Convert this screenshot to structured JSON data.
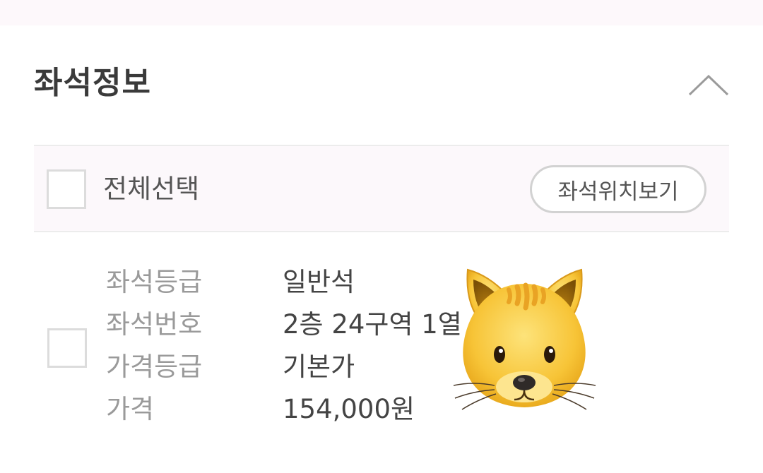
{
  "section": {
    "title": "좌석정보",
    "collapse_icon": "chevron-up-icon"
  },
  "select_bar": {
    "select_all_label": "전체선택",
    "seat_location_button": "좌석위치보기"
  },
  "seat_item": {
    "rows": [
      {
        "label": "좌석등급",
        "value": "일반석"
      },
      {
        "label": "좌석번호",
        "value": "2층 24구역 1열"
      },
      {
        "label": "가격등급",
        "value": "기본가"
      },
      {
        "label": "가격",
        "value": "154,000원"
      }
    ]
  },
  "overlay": {
    "sticker_icon": "cat-face-icon"
  }
}
